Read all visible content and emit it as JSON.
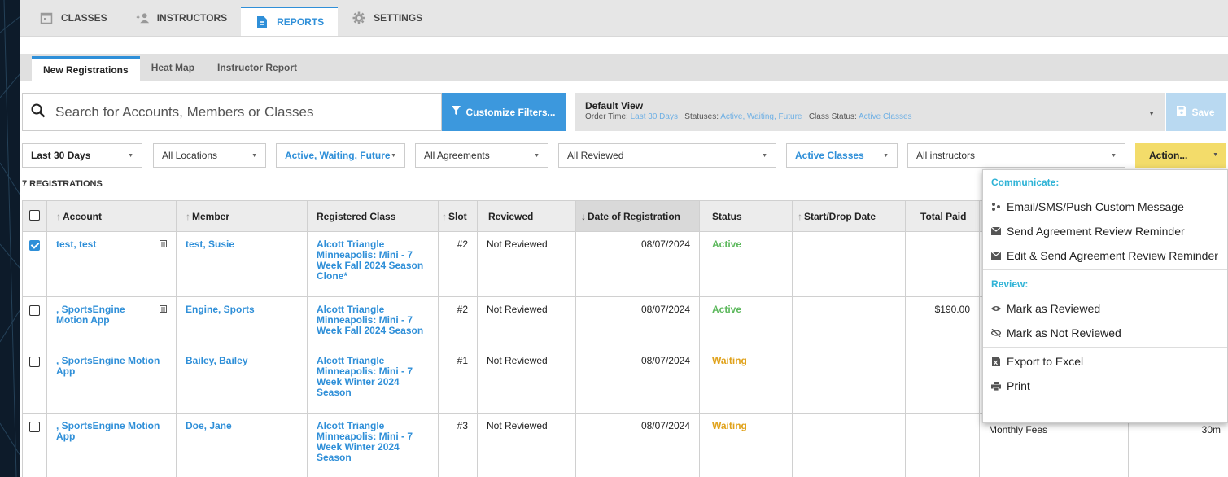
{
  "main_tabs": [
    {
      "label": "CLASSES",
      "icon": "calendar-icon"
    },
    {
      "label": "INSTRUCTORS",
      "icon": "people-icon"
    },
    {
      "label": "REPORTS",
      "icon": "document-icon",
      "active": true
    },
    {
      "label": "SETTINGS",
      "icon": "gear-icon"
    }
  ],
  "sub_tabs": [
    {
      "label": "New Registrations",
      "active": true
    },
    {
      "label": "Heat Map"
    },
    {
      "label": "Instructor Report"
    }
  ],
  "search": {
    "placeholder": "Search for Accounts, Members or Classes"
  },
  "customize_filters_label": "Customize Filters...",
  "default_view": {
    "title": "Default View",
    "order_time_label": "Order Time:",
    "order_time_value": "Last 30 Days",
    "statuses_label": "Statuses:",
    "statuses_value": "Active, Waiting, Future",
    "class_status_label": "Class Status:",
    "class_status_value": "Active Classes"
  },
  "save_label": "Save",
  "filters": {
    "period": "Last 30 Days",
    "locations": "All Locations",
    "statuses": "Active, Waiting, Future",
    "agreements": "All Agreements",
    "reviewed": "All Reviewed",
    "class_status": "Active Classes",
    "instructors": "All instructors"
  },
  "action_label": "Action...",
  "registrations_count": "7 REGISTRATIONS",
  "columns": {
    "account": "Account",
    "member": "Member",
    "registered_class": "Registered Class",
    "slot": "Slot",
    "reviewed": "Reviewed",
    "date_of_registration": "Date of Registration",
    "status": "Status",
    "start_drop_date": "Start/Drop Date",
    "total_paid": "Total Paid"
  },
  "rows": [
    {
      "checked": true,
      "account": "test, test",
      "member": "test, Susie",
      "class": "Alcott Triangle Minneapolis: Mini - 7 Week Fall 2024 Season Clone*",
      "slot": "#2",
      "reviewed": "Not Reviewed",
      "date": "08/07/2024",
      "status": "Active",
      "total_paid": "",
      "extra1": "",
      "extra2": ""
    },
    {
      "checked": false,
      "account": ", SportsEngine Motion App",
      "member": "Engine, Sports",
      "class": "Alcott Triangle Minneapolis: Mini - 7 Week Fall 2024 Season",
      "slot": "#2",
      "reviewed": "Not Reviewed",
      "date": "08/07/2024",
      "status": "Active",
      "total_paid": "$190.00",
      "extra1": "",
      "extra2": ""
    },
    {
      "checked": false,
      "account": ", SportsEngine Motion App",
      "member": "Bailey, Bailey",
      "class": "Alcott Triangle Minneapolis: Mini - 7 Week Winter 2024 Season",
      "slot": "#1",
      "reviewed": "Not Reviewed",
      "date": "08/07/2024",
      "status": "Waiting",
      "total_paid": "",
      "extra1": "",
      "extra2": ""
    },
    {
      "checked": false,
      "account": ", SportsEngine Motion App",
      "member": "Doe, Jane",
      "class": "Alcott Triangle Minneapolis: Mini - 7 Week Winter 2024 Season",
      "slot": "#3",
      "reviewed": "Not Reviewed",
      "date": "08/07/2024",
      "status": "Waiting",
      "total_paid": "",
      "extra1": "Monthly Fees",
      "extra2": "30m"
    }
  ],
  "action_menu": {
    "communicate_header": "Communicate:",
    "communicate_items": [
      {
        "label": "Email/SMS/Push Custom Message",
        "icon": "users-message-icon"
      },
      {
        "label": "Send Agreement Review Reminder",
        "icon": "envelope-icon"
      },
      {
        "label": "Edit & Send Agreement Review Reminder",
        "icon": "envelope-icon"
      }
    ],
    "review_header": "Review:",
    "review_items": [
      {
        "label": "Mark as Reviewed",
        "icon": "eye-icon"
      },
      {
        "label": "Mark as Not Reviewed",
        "icon": "eye-slash-icon"
      }
    ],
    "other_items": [
      {
        "label": "Export to Excel",
        "icon": "excel-icon"
      },
      {
        "label": "Print",
        "icon": "printer-icon"
      }
    ]
  },
  "colors": {
    "accent_blue": "#2f8fd8",
    "active_green": "#5cb85c",
    "waiting_orange": "#e0a21b",
    "action_yellow": "#f3dc6a",
    "menu_header_cyan": "#2fb3d6"
  }
}
